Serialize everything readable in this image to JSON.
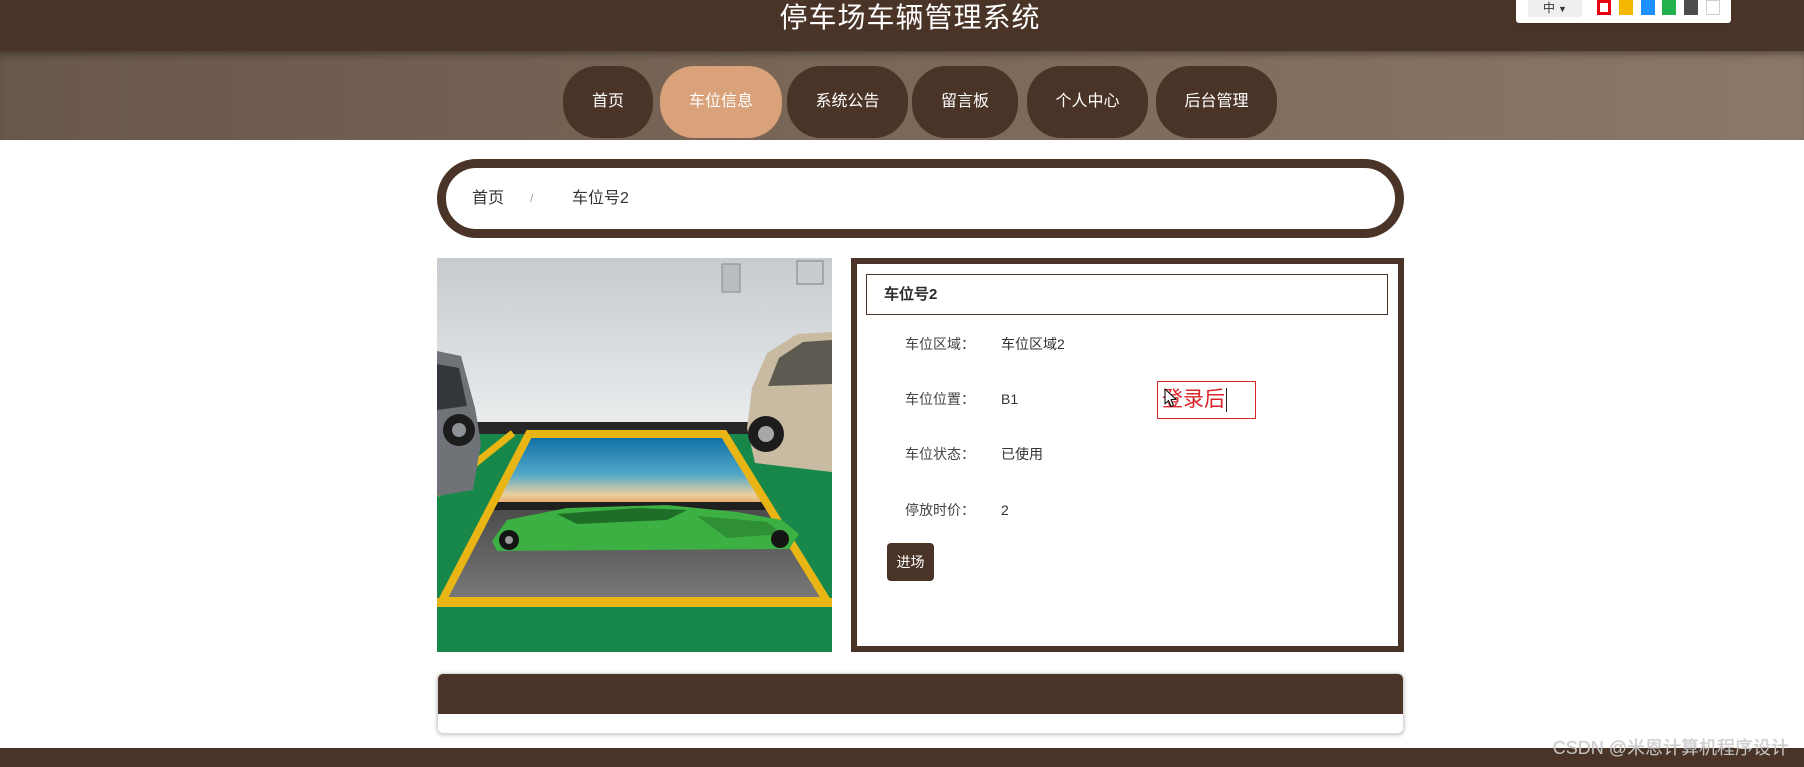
{
  "header": {
    "title": "停车场车辆管理系统"
  },
  "toolbar": {
    "language": "中",
    "theme_colors": [
      "#e60012",
      "#f5b800",
      "#1e8fff",
      "#22b14c",
      "#4d4d4d",
      "#ffffff"
    ],
    "selected_theme": 0
  },
  "nav": {
    "items": [
      {
        "label": "首页",
        "active": false
      },
      {
        "label": "车位信息",
        "active": true
      },
      {
        "label": "系统公告",
        "active": false
      },
      {
        "label": "留言板",
        "active": false
      },
      {
        "label": "个人中心",
        "active": false
      },
      {
        "label": "后台管理",
        "active": false
      }
    ]
  },
  "breadcrumb": {
    "home": "首页",
    "separator": "/",
    "current": "车位号2"
  },
  "detail": {
    "title": "车位号2",
    "fields": [
      {
        "label": "车位区域：",
        "value": "车位区域2"
      },
      {
        "label": "车位位置：",
        "value": "B1"
      },
      {
        "label": "车位状态：",
        "value": "已使用"
      },
      {
        "label": "停放时价：",
        "value": "2"
      }
    ],
    "enter_button": "进场"
  },
  "annotation": {
    "text": "登录后"
  },
  "colors": {
    "primary": "#4a3427",
    "accent": "#d9a27a",
    "annotation": "#d9262b"
  },
  "watermark": "CSDN @米恩计算机程序设计"
}
